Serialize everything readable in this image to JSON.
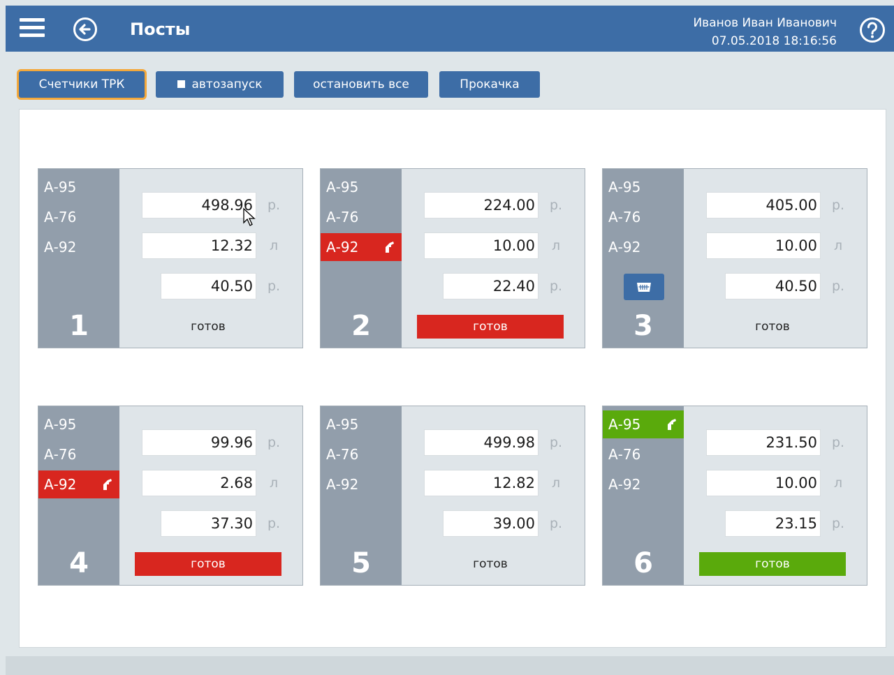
{
  "header": {
    "title": "Посты",
    "user_name": "Иванов Иван Иванович",
    "datetime": "07.05.2018 18:16:56",
    "color": "#3d6da6"
  },
  "toolbar": {
    "counters_label": "Счетчики ТРК",
    "autostart_label": "автозапуск",
    "stop_all_label": "остановить все",
    "pumping_label": "Прокачка"
  },
  "units": {
    "money": "р.",
    "liters": "л"
  },
  "posts": [
    {
      "number": "1",
      "fuels": [
        "А-95",
        "А-76",
        "А-92"
      ],
      "amount": "498.96",
      "liters": "12.32",
      "price": "40.50",
      "status": "готов"
    },
    {
      "number": "2",
      "fuels": [
        "А-95",
        "А-76",
        "А-92"
      ],
      "amount": "224.00",
      "liters": "10.00",
      "price": "22.40",
      "status": "готов"
    },
    {
      "number": "3",
      "fuels": [
        "А-95",
        "А-76",
        "А-92"
      ],
      "amount": "405.00",
      "liters": "10.00",
      "price": "40.50",
      "status": "готов"
    },
    {
      "number": "4",
      "fuels": [
        "А-95",
        "А-76",
        "А-92"
      ],
      "amount": "99.96",
      "liters": "2.68",
      "price": "37.30",
      "status": "готов"
    },
    {
      "number": "5",
      "fuels": [
        "А-95",
        "А-76",
        "А-92"
      ],
      "amount": "499.98",
      "liters": "12.82",
      "price": "39.00",
      "status": "готов"
    },
    {
      "number": "6",
      "fuels": [
        "А-95",
        "А-76",
        "А-92"
      ],
      "amount": "231.50",
      "liters": "10.00",
      "price": "23.15",
      "status": "готов"
    }
  ],
  "colors": {
    "active_red": "#d8261f",
    "active_green": "#5aaa0c",
    "selected_outline": "#f3a83b"
  }
}
